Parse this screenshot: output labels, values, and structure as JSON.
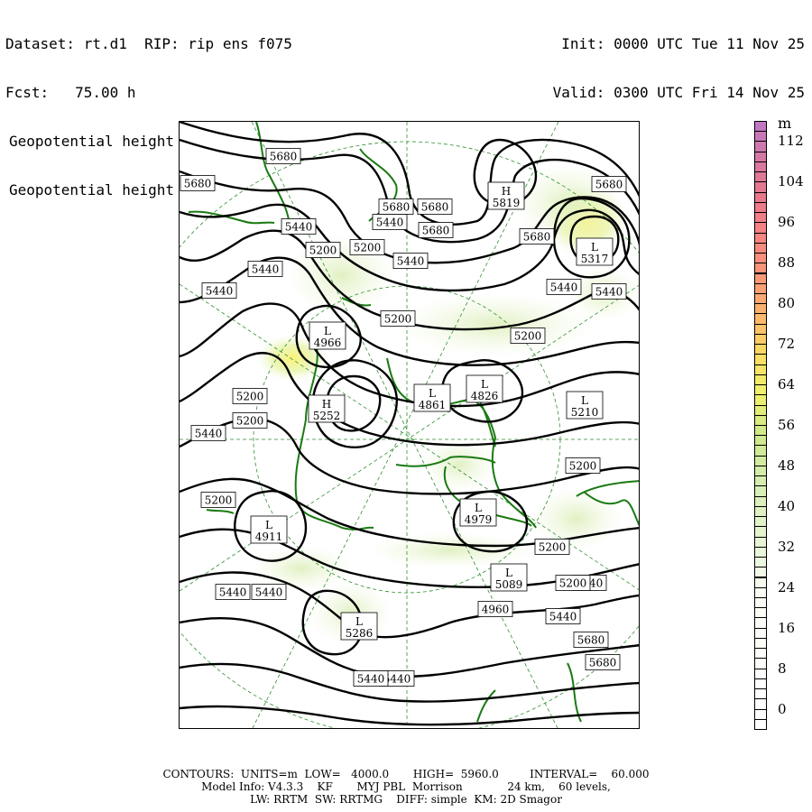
{
  "header": {
    "dataset_line": "Dataset: rt.d1  RIP: rip ens f075",
    "fcst_line": "Fcst:   75.00 h",
    "field_line_1": "Geopotential height",
    "field_line_2": "Geopotential height",
    "init_line": "Init: 0000 UTC Tue 11 Nov 25",
    "valid_line": "Valid: 0300 UTC Fri 14 Nov 25"
  },
  "colors": {
    "contour": "#000000",
    "coastline": "#1a7a12",
    "grid": "#2f8f2f",
    "shade_low": "#eef7dc",
    "shade_mid": "#dff0bf",
    "shade_high": "#fbf27a"
  },
  "scale": {
    "unit": "m",
    "labels": [
      "0",
      "8",
      "16",
      "24",
      "32",
      "40",
      "48",
      "56",
      "64",
      "72",
      "80",
      "88",
      "96",
      "104",
      "112"
    ],
    "min": 0,
    "max": 120,
    "step": 2
  },
  "map": {
    "contour_labels": [
      "5680",
      "5680",
      "5680",
      "5680",
      "5680",
      "5680",
      "5680",
      "5680",
      "5680",
      "5440",
      "5440",
      "5440",
      "5440",
      "5440",
      "5440",
      "5440",
      "5440",
      "5440",
      "5440",
      "5440",
      "5440",
      "5440",
      "5440",
      "5200",
      "5200",
      "5200",
      "5200",
      "5200",
      "5200",
      "5200",
      "5200",
      "5200",
      "5200",
      "4960"
    ],
    "centers": [
      {
        "type": "H",
        "value": "5819"
      },
      {
        "type": "L",
        "value": "5317"
      },
      {
        "type": "L",
        "value": "4966"
      },
      {
        "type": "H",
        "value": "5252"
      },
      {
        "type": "L",
        "value": "4861"
      },
      {
        "type": "L",
        "value": "4826"
      },
      {
        "type": "L",
        "value": "5210"
      },
      {
        "type": "L",
        "value": "4911"
      },
      {
        "type": "L",
        "value": "4979"
      },
      {
        "type": "L",
        "value": "5089"
      },
      {
        "type": "L",
        "value": "5286"
      }
    ]
  },
  "footer": {
    "line_1": "CONTOURS:  UNITS=m  LOW=   4000.0       HIGH=  5960.0         INTERVAL=    60.000",
    "line_2": "Model Info: V4.3.3    KF       MYJ PBL  Morrison             24 km,    60 levels,",
    "line_3": "LW: RRTM  SW: RRTMG    DIFF: simple  KM: 2D Smagor"
  }
}
